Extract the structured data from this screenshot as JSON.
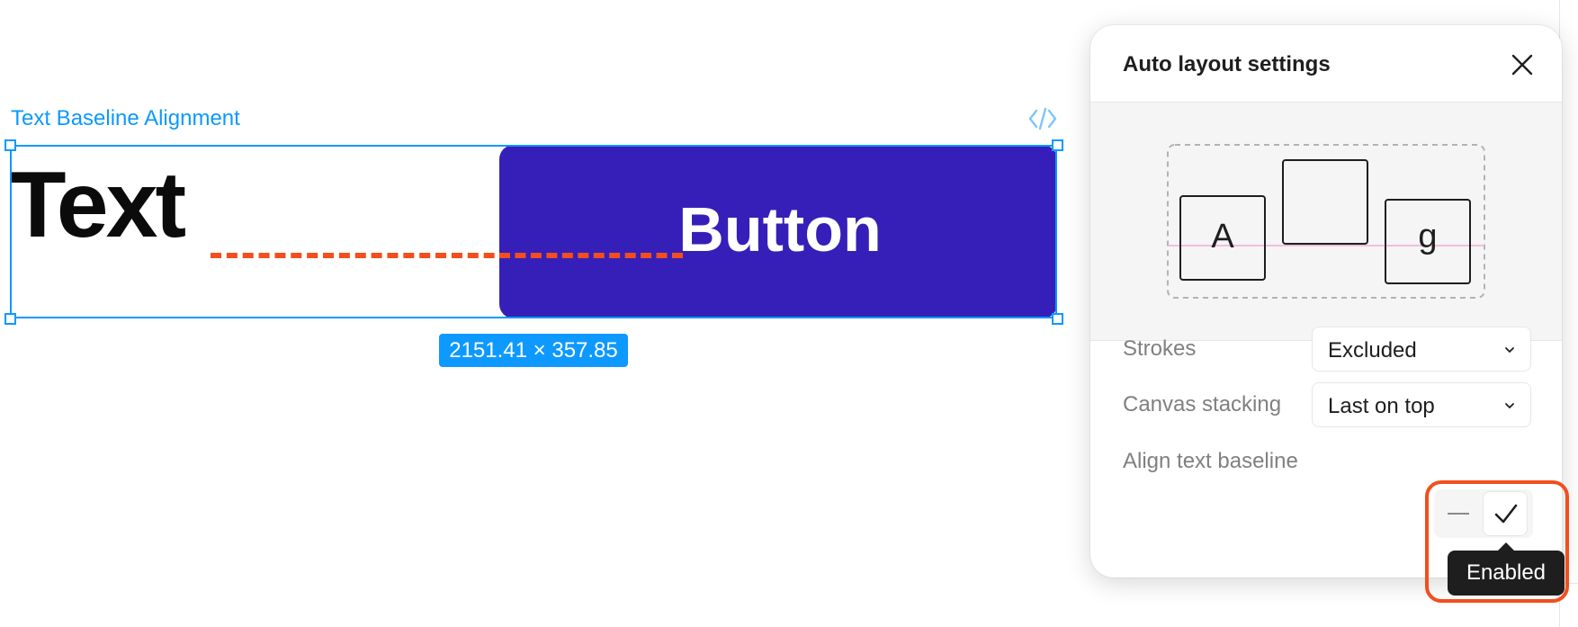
{
  "canvas": {
    "frame_label": "Text Baseline Alignment",
    "text_layer": "Text",
    "button_label": "Button",
    "dimensions": "2151.41 × 357.85",
    "colors": {
      "selection": "#0d99ff",
      "button": "#361fb8",
      "baseline_guide": "#f24e1e"
    }
  },
  "panel": {
    "title": "Auto layout settings",
    "close_icon": "close-icon",
    "preview": {
      "box_a": "A",
      "box_g": "g"
    },
    "strokes": {
      "label": "Strokes",
      "value": "Excluded"
    },
    "canvas_stacking": {
      "label": "Canvas stacking",
      "value": "Last on top"
    },
    "align_baseline": {
      "label": "Align text baseline",
      "options": [
        "off",
        "on"
      ],
      "selected": "on",
      "tooltip": "Enabled"
    }
  }
}
